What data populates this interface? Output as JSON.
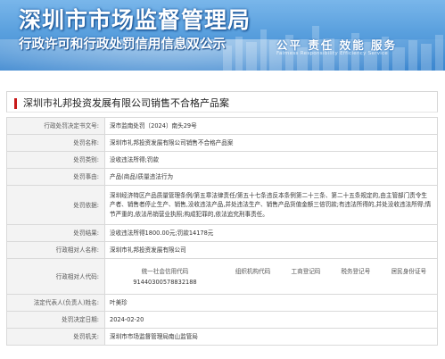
{
  "banner": {
    "title": "深圳市市场监督管理局",
    "subtitle": "行政许可和行政处罚信用信息双公示",
    "slogan": "公平  责任  效能  服务",
    "slogan_en": "Fairness  Responsibility  Efficiency  Service"
  },
  "page_title": "深圳市礼邦投资发展有限公司销售不合格产品案",
  "rows": {
    "decision_no": {
      "label": "行政处罚决定书文号:",
      "value": "深市监南处罚〔2024〕南头29号"
    },
    "case_name": {
      "label": "处罚名称:",
      "value": "深圳市礼邦投资发展有限公司销售不合格产品案"
    },
    "category": {
      "label": "处罚类别:",
      "value": "没收违法所得;罚款"
    },
    "reason": {
      "label": "处罚事由:",
      "value": "产品(商品)质量违法行为"
    },
    "basis": {
      "label": "处罚依据:",
      "value": "深圳经济特区产品质量管理条例/第五章法律责任/第五十七条违反本条例第二十三条、第二十五条规定的,由主管部门责令生产者、销售者停止生产、销售,没收违法产品,并处违法生产、销售产品货值金额三倍罚款;有违法所得的,并处没收违法所得;情节严重的,依法吊销营业执照;构成犯罪的,依法追究刑事责任。"
    },
    "result": {
      "label": "处罚结果:",
      "value": "没收违法所得1800.00元;罚款14178元"
    },
    "party": {
      "label": "行政相对人名称:",
      "value": "深圳市礼邦投资发展有限公司"
    },
    "party_code": {
      "label": "行政相对人代码:",
      "headers": [
        "统一社会信用代码",
        "组织机构代码",
        "工商登记码",
        "税务登记号",
        "居民身份证号"
      ],
      "values": [
        "91440300578832188",
        "",
        "",
        "",
        ""
      ]
    },
    "legal_rep": {
      "label": "法定代表人(负责人)姓名:",
      "value": "叶美珍"
    },
    "decision_date": {
      "label": "处罚决定日期:",
      "value": "2024-02-20"
    },
    "authority": {
      "label": "处罚机关:",
      "value": "深圳市市场监督管理局南山监管局"
    }
  }
}
